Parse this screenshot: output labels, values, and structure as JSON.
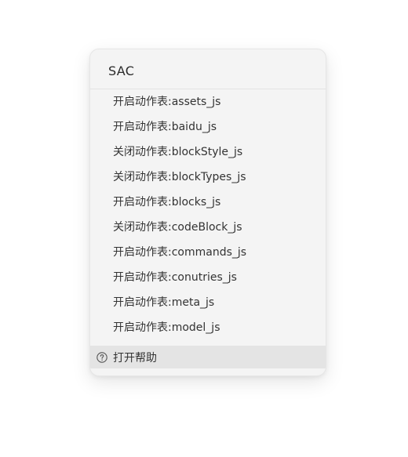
{
  "menu": {
    "title": "SAC",
    "items": [
      {
        "label": "开启动作表:assets_js"
      },
      {
        "label": "开启动作表:baidu_js"
      },
      {
        "label": "关闭动作表:blockStyle_js"
      },
      {
        "label": "关闭动作表:blockTypes_js"
      },
      {
        "label": "开启动作表:blocks_js"
      },
      {
        "label": "关闭动作表:codeBlock_js"
      },
      {
        "label": "开启动作表:commands_js"
      },
      {
        "label": "开启动作表:conutries_js"
      },
      {
        "label": "开启动作表:meta_js"
      },
      {
        "label": "开启动作表:model_js"
      }
    ],
    "help": {
      "label": "打开帮助",
      "icon": "question-circle-icon"
    }
  }
}
